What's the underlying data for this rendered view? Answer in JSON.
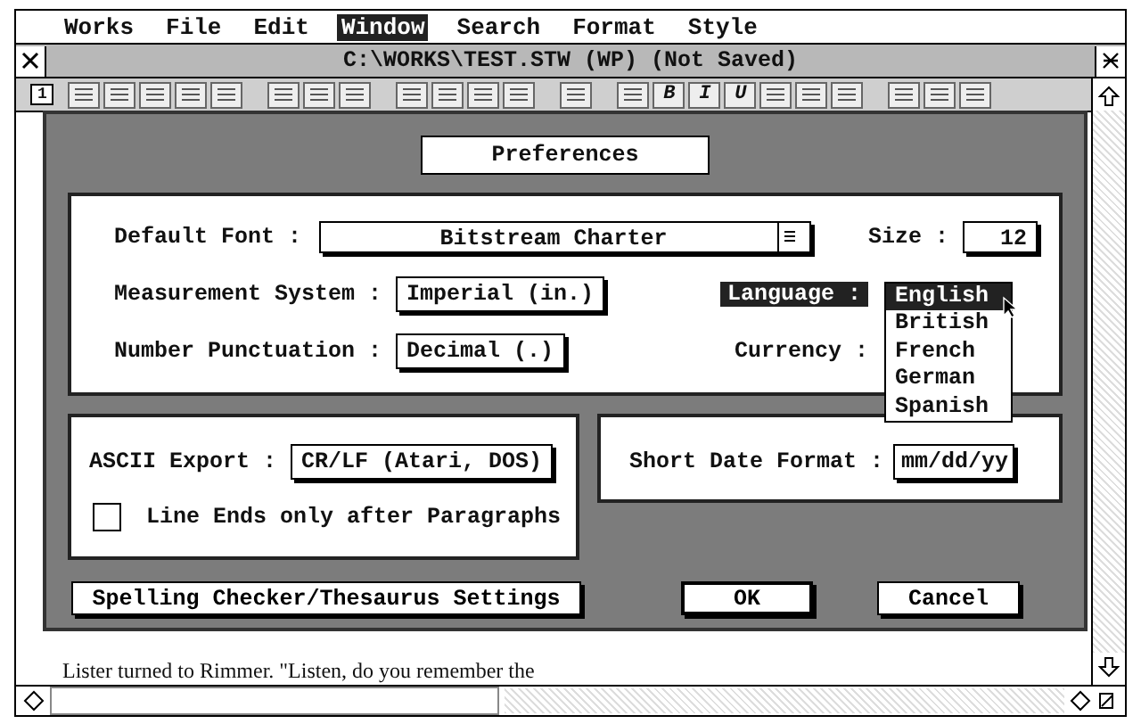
{
  "menu_bar": [
    {
      "label": "Works",
      "selected": false
    },
    {
      "label": "File",
      "selected": false
    },
    {
      "label": "Edit",
      "selected": false
    },
    {
      "label": "Window",
      "selected": true
    },
    {
      "label": "Search",
      "selected": false
    },
    {
      "label": "Format",
      "selected": false
    },
    {
      "label": "Style",
      "selected": false
    }
  ],
  "window": {
    "title": "C:\\WORKS\\TEST.STW (WP) (Not Saved)"
  },
  "toolbar": {
    "page": "1",
    "buttons": [
      {
        "kind": "lines"
      },
      {
        "kind": "lines"
      },
      {
        "kind": "lines"
      },
      {
        "kind": "lines"
      },
      {
        "kind": "lines"
      },
      {
        "kind": "gap"
      },
      {
        "kind": "lines"
      },
      {
        "kind": "lines"
      },
      {
        "kind": "lines"
      },
      {
        "kind": "gap"
      },
      {
        "kind": "lines"
      },
      {
        "kind": "lines"
      },
      {
        "kind": "lines"
      },
      {
        "kind": "lines"
      },
      {
        "kind": "gap"
      },
      {
        "kind": "lines"
      },
      {
        "kind": "gap"
      },
      {
        "kind": "lines"
      },
      {
        "kind": "letter",
        "label": "B"
      },
      {
        "kind": "letter",
        "label": "I"
      },
      {
        "kind": "letter",
        "label": "U"
      },
      {
        "kind": "lines"
      },
      {
        "kind": "lines"
      },
      {
        "kind": "lines"
      },
      {
        "kind": "gap"
      },
      {
        "kind": "lines"
      },
      {
        "kind": "lines"
      },
      {
        "kind": "lines"
      }
    ]
  },
  "dialog": {
    "title": "Preferences",
    "default_font": {
      "label": "Default Font :",
      "value": "Bitstream Charter"
    },
    "size": {
      "label": "Size :",
      "value": "12"
    },
    "measurement": {
      "label": "Measurement System :",
      "value": "Imperial (in.)"
    },
    "language": {
      "label": "Language :",
      "highlighted": true,
      "options": [
        {
          "label": "English",
          "selected": true
        },
        {
          "label": "British",
          "selected": false
        },
        {
          "label": "French",
          "selected": false
        },
        {
          "label": "German",
          "selected": false
        },
        {
          "label": "Spanish",
          "selected": false
        }
      ]
    },
    "punctuation": {
      "label": "Number Punctuation :",
      "value": "Decimal (.)"
    },
    "currency": {
      "label": "Currency :"
    },
    "ascii_export": {
      "label": "ASCII Export :",
      "value": "CR/LF (Atari, DOS)"
    },
    "line_ends": {
      "label": "Line Ends only after Paragraphs",
      "checked": false
    },
    "short_date": {
      "label": "Short Date Format :",
      "value": "mm/dd/yy"
    },
    "buttons": [
      {
        "label": "Spelling Checker/Thesaurus Settings",
        "kind": "wide"
      },
      {
        "label": "OK",
        "kind": "default"
      },
      {
        "label": "Cancel",
        "kind": "normal"
      }
    ]
  },
  "document": {
    "text": "Lister turned to Rimmer. \"Listen, do you remember the"
  }
}
